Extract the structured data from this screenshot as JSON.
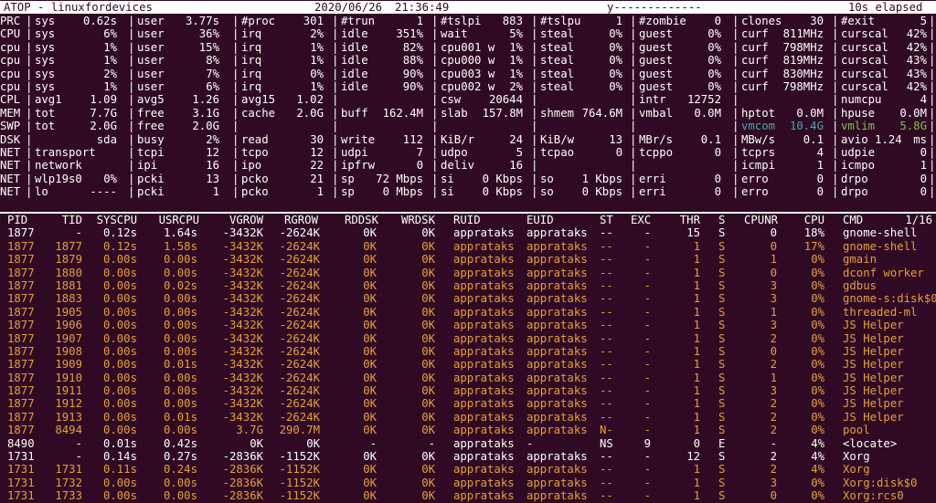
{
  "header": {
    "title": "ATOP - linuxfordevices",
    "date": "2020/06/26",
    "time": "21:36:49",
    "mode": "y-------------",
    "elapsed": "10s elapsed"
  },
  "system_rows": [
    {
      "label": "PRC",
      "cells": [
        [
          "sys",
          "0.62s"
        ],
        [
          "user",
          "3.77s"
        ],
        [
          "#proc",
          "301"
        ],
        [
          "#trun",
          "1"
        ],
        [
          "#tslpi",
          "883"
        ],
        [
          "#tslpu",
          "1"
        ],
        [
          "#zombie",
          "0"
        ],
        [
          "clones",
          "30"
        ],
        [
          "#exit",
          "5"
        ]
      ]
    },
    {
      "label": "CPU",
      "cells": [
        [
          "sys",
          "6%"
        ],
        [
          "user",
          "36%"
        ],
        [
          "irq",
          "2%"
        ],
        [
          "idle",
          "351%"
        ],
        [
          "wait",
          "5%"
        ],
        [
          "steal",
          "0%"
        ],
        [
          "guest",
          "0%"
        ],
        [
          "curf",
          "811MHz"
        ],
        [
          "curscal",
          "42%"
        ]
      ]
    },
    {
      "label": "cpu",
      "cells": [
        [
          "sys",
          "1%"
        ],
        [
          "user",
          "15%"
        ],
        [
          "irq",
          "1%"
        ],
        [
          "idle",
          "82%"
        ],
        [
          "cpu001 w",
          "1%"
        ],
        [
          "steal",
          "0%"
        ],
        [
          "guest",
          "0%"
        ],
        [
          "curf",
          "798MHz"
        ],
        [
          "curscal",
          "42%"
        ]
      ]
    },
    {
      "label": "cpu",
      "cells": [
        [
          "sys",
          "1%"
        ],
        [
          "user",
          "8%"
        ],
        [
          "irq",
          "1%"
        ],
        [
          "idle",
          "88%"
        ],
        [
          "cpu000 w",
          "1%"
        ],
        [
          "steal",
          "0%"
        ],
        [
          "guest",
          "0%"
        ],
        [
          "curf",
          "819MHz"
        ],
        [
          "curscal",
          "43%"
        ]
      ]
    },
    {
      "label": "cpu",
      "cells": [
        [
          "sys",
          "2%"
        ],
        [
          "user",
          "7%"
        ],
        [
          "irq",
          "0%"
        ],
        [
          "idle",
          "90%"
        ],
        [
          "cpu003 w",
          "1%"
        ],
        [
          "steal",
          "0%"
        ],
        [
          "guest",
          "0%"
        ],
        [
          "curf",
          "830MHz"
        ],
        [
          "curscal",
          "43%"
        ]
      ]
    },
    {
      "label": "cpu",
      "cells": [
        [
          "sys",
          "1%"
        ],
        [
          "user",
          "6%"
        ],
        [
          "irq",
          "1%"
        ],
        [
          "idle",
          "90%"
        ],
        [
          "cpu002 w",
          "2%"
        ],
        [
          "steal",
          "0%"
        ],
        [
          "guest",
          "0%"
        ],
        [
          "curf",
          "798MHz"
        ],
        [
          "curscal",
          "42%"
        ]
      ]
    },
    {
      "label": "CPL",
      "cells": [
        [
          "avg1",
          "1.09"
        ],
        [
          "avg5",
          "1.26"
        ],
        [
          "avg15",
          "1.02"
        ],
        [
          "",
          ""
        ],
        [
          "csw",
          "20644"
        ],
        [
          "",
          ""
        ],
        [
          "intr",
          "12752"
        ],
        [
          "",
          ""
        ],
        [
          "numcpu",
          "4"
        ]
      ]
    },
    {
      "label": "MEM",
      "cells": [
        [
          "tot",
          "7.7G"
        ],
        [
          "free",
          "3.1G"
        ],
        [
          "cache",
          "2.0G"
        ],
        [
          "buff",
          "162.4M"
        ],
        [
          "slab",
          "157.8M"
        ],
        [
          "shmem",
          "764.6M"
        ],
        [
          "vmbal",
          "0.0M"
        ],
        [
          "hptot",
          "0.0M"
        ],
        [
          "hpuse",
          "0.0M"
        ]
      ]
    },
    {
      "label": "SWP",
      "cells": [
        [
          "tot",
          "2.0G"
        ],
        [
          "free",
          "2.0G"
        ],
        [
          "",
          ""
        ],
        [
          "",
          ""
        ],
        [
          "",
          ""
        ],
        [
          "",
          ""
        ],
        [
          "",
          ""
        ],
        [
          "vmcom",
          "10.4G"
        ],
        [
          "vmlim",
          "5.8G"
        ]
      ]
    },
    {
      "label": "DSK",
      "cells": [
        [
          "",
          "sda"
        ],
        [
          "busy",
          "2%"
        ],
        [
          "read",
          "30"
        ],
        [
          "write",
          "112"
        ],
        [
          "KiB/r",
          "24"
        ],
        [
          "KiB/w",
          "13"
        ],
        [
          "MBr/s",
          "0.1"
        ],
        [
          "MBw/s",
          "0.1"
        ],
        [
          "avio 1.24",
          "ms"
        ]
      ]
    },
    {
      "label": "NET",
      "cells": [
        [
          "transport",
          ""
        ],
        [
          "tcpi",
          "12"
        ],
        [
          "tcpo",
          "12"
        ],
        [
          "udpi",
          "7"
        ],
        [
          "udpo",
          "5"
        ],
        [
          "tcpao",
          "0"
        ],
        [
          "tcppo",
          "0"
        ],
        [
          "tcprs",
          "4"
        ],
        [
          "udpie",
          "0"
        ]
      ]
    },
    {
      "label": "NET",
      "cells": [
        [
          "network",
          ""
        ],
        [
          "ipi",
          "16"
        ],
        [
          "ipo",
          "22"
        ],
        [
          "ipfrw",
          "0"
        ],
        [
          "deliv",
          "16"
        ],
        [
          "",
          ""
        ],
        [
          "",
          ""
        ],
        [
          "icmpi",
          "1"
        ],
        [
          "icmpo",
          "1"
        ]
      ]
    },
    {
      "label": "NET",
      "cells": [
        [
          "wlp19s0",
          "0%"
        ],
        [
          "pcki",
          "13"
        ],
        [
          "pcko",
          "21"
        ],
        [
          "sp",
          "72 Mbps"
        ],
        [
          "si",
          "0 Kbps"
        ],
        [
          "so",
          "1 Kbps"
        ],
        [
          "erri",
          "0"
        ],
        [
          "erro",
          "0"
        ],
        [
          "drpo",
          "0"
        ]
      ]
    },
    {
      "label": "NET",
      "cells": [
        [
          "lo",
          "----"
        ],
        [
          "pcki",
          "1"
        ],
        [
          "pcko",
          "1"
        ],
        [
          "sp",
          "0 Mbps"
        ],
        [
          "si",
          "0 Kbps"
        ],
        [
          "so",
          "0 Kbps"
        ],
        [
          "erri",
          "0"
        ],
        [
          "erro",
          "0"
        ],
        [
          "drpo",
          "0"
        ]
      ]
    }
  ],
  "columns": [
    "PID",
    "TID",
    "SYSCPU",
    "USRCPU",
    "VGROW",
    "RGROW",
    "RDDSK",
    "WRDSK",
    "RUID",
    "EUID",
    "ST",
    "EXC",
    "THR",
    "S",
    "CPUNR",
    "CPU",
    "CMD",
    "1/16"
  ],
  "processes": [
    [
      "1877",
      "-",
      "0.12s",
      "1.64s",
      "-3432K",
      "-2624K",
      "0K",
      "0K",
      "apprataks",
      "apprataks",
      "--",
      "-",
      "15",
      "S",
      "0",
      "18%",
      "gnome-shell"
    ],
    [
      "1877",
      "1877",
      "0.12s",
      "1.58s",
      "-3432K",
      "-2624K",
      "0K",
      "0K",
      "apprataks",
      "apprataks",
      "--",
      "-",
      "1",
      "S",
      "0",
      "17%",
      "gnome-shell"
    ],
    [
      "1877",
      "1879",
      "0.00s",
      "0.00s",
      "-3432K",
      "-2624K",
      "0K",
      "0K",
      "apprataks",
      "apprataks",
      "--",
      "-",
      "1",
      "S",
      "1",
      "0%",
      "gmain"
    ],
    [
      "1877",
      "1880",
      "0.00s",
      "0.00s",
      "-3432K",
      "-2624K",
      "0K",
      "0K",
      "apprataks",
      "apprataks",
      "--",
      "-",
      "1",
      "S",
      "0",
      "0%",
      "dconf worker"
    ],
    [
      "1877",
      "1881",
      "0.00s",
      "0.02s",
      "-3432K",
      "-2624K",
      "0K",
      "0K",
      "apprataks",
      "apprataks",
      "--",
      "-",
      "1",
      "S",
      "3",
      "0%",
      "gdbus"
    ],
    [
      "1877",
      "1883",
      "0.00s",
      "0.00s",
      "-3432K",
      "-2624K",
      "0K",
      "0K",
      "apprataks",
      "apprataks",
      "--",
      "-",
      "1",
      "S",
      "3",
      "0%",
      "gnome-s:disk$0"
    ],
    [
      "1877",
      "1905",
      "0.00s",
      "0.00s",
      "-3432K",
      "-2624K",
      "0K",
      "0K",
      "apprataks",
      "apprataks",
      "--",
      "-",
      "1",
      "S",
      "1",
      "0%",
      "threaded-ml"
    ],
    [
      "1877",
      "1906",
      "0.00s",
      "0.00s",
      "-3432K",
      "-2624K",
      "0K",
      "0K",
      "apprataks",
      "apprataks",
      "--",
      "-",
      "1",
      "S",
      "3",
      "0%",
      "JS Helper"
    ],
    [
      "1877",
      "1907",
      "0.00s",
      "0.00s",
      "-3432K",
      "-2624K",
      "0K",
      "0K",
      "apprataks",
      "apprataks",
      "--",
      "-",
      "1",
      "S",
      "2",
      "0%",
      "JS Helper"
    ],
    [
      "1877",
      "1908",
      "0.00s",
      "0.00s",
      "-3432K",
      "-2624K",
      "0K",
      "0K",
      "apprataks",
      "apprataks",
      "--",
      "-",
      "1",
      "S",
      "0",
      "0%",
      "JS Helper"
    ],
    [
      "1877",
      "1909",
      "0.00s",
      "0.01s",
      "-3432K",
      "-2624K",
      "0K",
      "0K",
      "apprataks",
      "apprataks",
      "--",
      "-",
      "1",
      "S",
      "2",
      "0%",
      "JS Helper"
    ],
    [
      "1877",
      "1910",
      "0.00s",
      "0.00s",
      "-3432K",
      "-2624K",
      "0K",
      "0K",
      "apprataks",
      "apprataks",
      "--",
      "-",
      "1",
      "S",
      "1",
      "0%",
      "JS Helper"
    ],
    [
      "1877",
      "1911",
      "0.00s",
      "0.00s",
      "-3432K",
      "-2624K",
      "0K",
      "0K",
      "apprataks",
      "apprataks",
      "--",
      "-",
      "1",
      "S",
      "3",
      "0%",
      "JS Helper"
    ],
    [
      "1877",
      "1912",
      "0.00s",
      "0.00s",
      "-3432K",
      "-2624K",
      "0K",
      "0K",
      "apprataks",
      "apprataks",
      "--",
      "-",
      "1",
      "S",
      "2",
      "0%",
      "JS Helper"
    ],
    [
      "1877",
      "1913",
      "0.00s",
      "0.01s",
      "-3432K",
      "-2624K",
      "0K",
      "0K",
      "apprataks",
      "apprataks",
      "--",
      "-",
      "1",
      "S",
      "2",
      "0%",
      "JS Helper"
    ],
    [
      "1877",
      "8494",
      "0.00s",
      "0.00s",
      "3.7G",
      "290.7M",
      "0K",
      "0K",
      "apprataks",
      "apprataks",
      "N-",
      "-",
      "1",
      "S",
      "2",
      "0%",
      "pool"
    ],
    [
      "8490",
      "-",
      "0.01s",
      "0.42s",
      "0K",
      "0K",
      "-",
      "-",
      "apprataks",
      "-",
      "NS",
      "9",
      "0",
      "E",
      "-",
      "4%",
      "<locate>"
    ],
    [
      "1731",
      "-",
      "0.14s",
      "0.27s",
      "-2836K",
      "-1152K",
      "0K",
      "0K",
      "apprataks",
      "apprataks",
      "--",
      "-",
      "12",
      "S",
      "2",
      "4%",
      "Xorg"
    ],
    [
      "1731",
      "1731",
      "0.11s",
      "0.24s",
      "-2836K",
      "-1152K",
      "0K",
      "0K",
      "apprataks",
      "apprataks",
      "--",
      "-",
      "1",
      "S",
      "2",
      "4%",
      "Xorg"
    ],
    [
      "1731",
      "1732",
      "0.00s",
      "0.00s",
      "-2836K",
      "-1152K",
      "0K",
      "0K",
      "apprataks",
      "apprataks",
      "--",
      "-",
      "1",
      "S",
      "3",
      "0%",
      "Xorg:disk$0"
    ],
    [
      "1731",
      "1733",
      "0.00s",
      "0.00s",
      "-2836K",
      "-1152K",
      "0K",
      "0K",
      "apprataks",
      "apprataks",
      "--",
      "-",
      "1",
      "S",
      "0",
      "0%",
      "Xorg:rcs0"
    ]
  ],
  "process_row_colors": [
    "white",
    "orange",
    "orange",
    "orange",
    "orange",
    "orange",
    "orange",
    "orange",
    "orange",
    "orange",
    "orange",
    "orange",
    "orange",
    "orange",
    "orange",
    "orange",
    "white",
    "white",
    "orange",
    "orange",
    "orange"
  ],
  "colors": {
    "background": "#300a24",
    "text": "#ffffff",
    "thread_text": "#e8a035",
    "vmcom": "#3fa9b5",
    "vmlim": "#79c840"
  }
}
